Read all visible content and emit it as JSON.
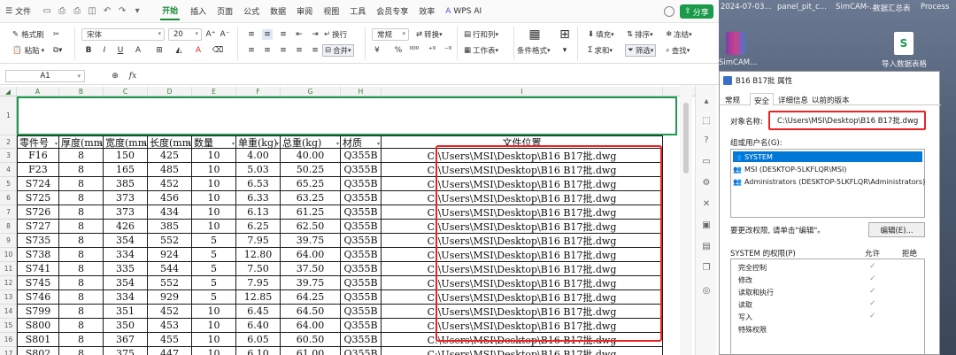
{
  "menubar": {
    "file": "文件",
    "tabs": [
      "开始",
      "插入",
      "页面",
      "公式",
      "数据",
      "审阅",
      "视图",
      "工具",
      "会员专享",
      "效率"
    ],
    "active": "开始",
    "wps_ai": "WPS AI",
    "share": "分享"
  },
  "ribbon": {
    "format_painter": "格式刷",
    "paste": "粘贴",
    "font": "宋体",
    "font_size": "20",
    "wrap": "换行",
    "merge": "合并",
    "number_format": "常规",
    "convert": "转换",
    "row_col": "行和列",
    "worksheet": "工作表",
    "cond_format": "条件格式",
    "fill": "填充",
    "sort": "排序",
    "freeze": "冻结",
    "sum": "求和",
    "filter": "筛选",
    "find": "查找",
    "percent": "%"
  },
  "formula": {
    "cell": "A1",
    "fx": "fx"
  },
  "columns": [
    "A",
    "B",
    "C",
    "D",
    "E",
    "F",
    "G",
    "H",
    "I"
  ],
  "rows": [
    "1",
    "2",
    "3",
    "4",
    "5",
    "6",
    "7",
    "8",
    "9",
    "10",
    "11",
    "12",
    "13",
    "14",
    "15",
    "16",
    "17"
  ],
  "headers": [
    "零件号",
    "厚度(mm)",
    "宽度(mm)",
    "长度(mm)",
    "数量",
    "单重(kg)",
    "总重(kg)",
    "材质",
    "文件位置"
  ],
  "data": [
    [
      "F16",
      "8",
      "150",
      "425",
      "10",
      "4.00",
      "40.00",
      "Q355B",
      "C:\\Users\\MSI\\Desktop\\B16 B17批.dwg"
    ],
    [
      "F23",
      "8",
      "165",
      "485",
      "10",
      "5.03",
      "50.25",
      "Q355B",
      "C:\\Users\\MSI\\Desktop\\B16 B17批.dwg"
    ],
    [
      "S724",
      "8",
      "385",
      "452",
      "10",
      "6.53",
      "65.25",
      "Q355B",
      "C:\\Users\\MSI\\Desktop\\B16 B17批.dwg"
    ],
    [
      "S725",
      "8",
      "373",
      "456",
      "10",
      "6.33",
      "63.25",
      "Q355B",
      "C:\\Users\\MSI\\Desktop\\B16 B17批.dwg"
    ],
    [
      "S726",
      "8",
      "373",
      "434",
      "10",
      "6.13",
      "61.25",
      "Q355B",
      "C:\\Users\\MSI\\Desktop\\B16 B17批.dwg"
    ],
    [
      "S727",
      "8",
      "426",
      "385",
      "10",
      "6.25",
      "62.50",
      "Q355B",
      "C:\\Users\\MSI\\Desktop\\B16 B17批.dwg"
    ],
    [
      "S735",
      "8",
      "354",
      "552",
      "5",
      "7.95",
      "39.75",
      "Q355B",
      "C:\\Users\\MSI\\Desktop\\B16 B17批.dwg"
    ],
    [
      "S738",
      "8",
      "334",
      "924",
      "5",
      "12.80",
      "64.00",
      "Q355B",
      "C:\\Users\\MSI\\Desktop\\B16 B17批.dwg"
    ],
    [
      "S741",
      "8",
      "335",
      "544",
      "5",
      "7.50",
      "37.50",
      "Q355B",
      "C:\\Users\\MSI\\Desktop\\B16 B17批.dwg"
    ],
    [
      "S745",
      "8",
      "354",
      "552",
      "5",
      "7.95",
      "39.75",
      "Q355B",
      "C:\\Users\\MSI\\Desktop\\B16 B17批.dwg"
    ],
    [
      "S746",
      "8",
      "334",
      "929",
      "5",
      "12.85",
      "64.25",
      "Q355B",
      "C:\\Users\\MSI\\Desktop\\B16 B17批.dwg"
    ],
    [
      "S799",
      "8",
      "351",
      "452",
      "10",
      "6.45",
      "64.50",
      "Q355B",
      "C:\\Users\\MSI\\Desktop\\B16 B17批.dwg"
    ],
    [
      "S800",
      "8",
      "350",
      "453",
      "10",
      "6.40",
      "64.00",
      "Q355B",
      "C:\\Users\\MSI\\Desktop\\B16 B17批.dwg"
    ],
    [
      "S801",
      "8",
      "367",
      "455",
      "10",
      "6.05",
      "60.50",
      "Q355B",
      "C:\\Users\\MSI\\Desktop\\B16 B17批.dwg"
    ],
    [
      "S802",
      "8",
      "375",
      "447",
      "10",
      "6.10",
      "61.00",
      "Q355B",
      "C:\\Users\\MSI\\Desktop\\B16 B17批.dwg"
    ]
  ],
  "desktop": {
    "top_labels": [
      "2024-07-03...",
      "panel_pit_c...",
      "SimCAM-...",
      "数据汇总表",
      "Process"
    ],
    "icon1_label": "SimCAM...",
    "icon2_label": "导入数据表格"
  },
  "dialog": {
    "title": "B16 B17批 属性",
    "tabs": [
      "常规",
      "安全",
      "详细信息",
      "以前的版本"
    ],
    "active_tab": "安全",
    "object_label": "对象名称:",
    "object_value": "C:\\Users\\MSI\\Desktop\\B16 B17批.dwg",
    "group_label": "组或用户名(G):",
    "users": [
      "SYSTEM",
      "MSI (DESKTOP-5LKFLQR\\MSI)",
      "Administrators (DESKTOP-5LKFLQR\\Administrators)"
    ],
    "change_hint": "要更改权限, 请单击\"编辑\"。",
    "edit_button": "编辑(E)...",
    "perm_label": "SYSTEM 的权限(P)",
    "allow": "允许",
    "deny": "拒绝",
    "perms": [
      "完全控制",
      "修改",
      "读取和执行",
      "读取",
      "写入",
      "特殊权限"
    ],
    "checked": [
      true,
      true,
      true,
      true,
      true,
      false
    ]
  },
  "colors": {
    "accent": "#1a9a4a",
    "highlight": "#e22222",
    "selection": "#0078d7"
  }
}
